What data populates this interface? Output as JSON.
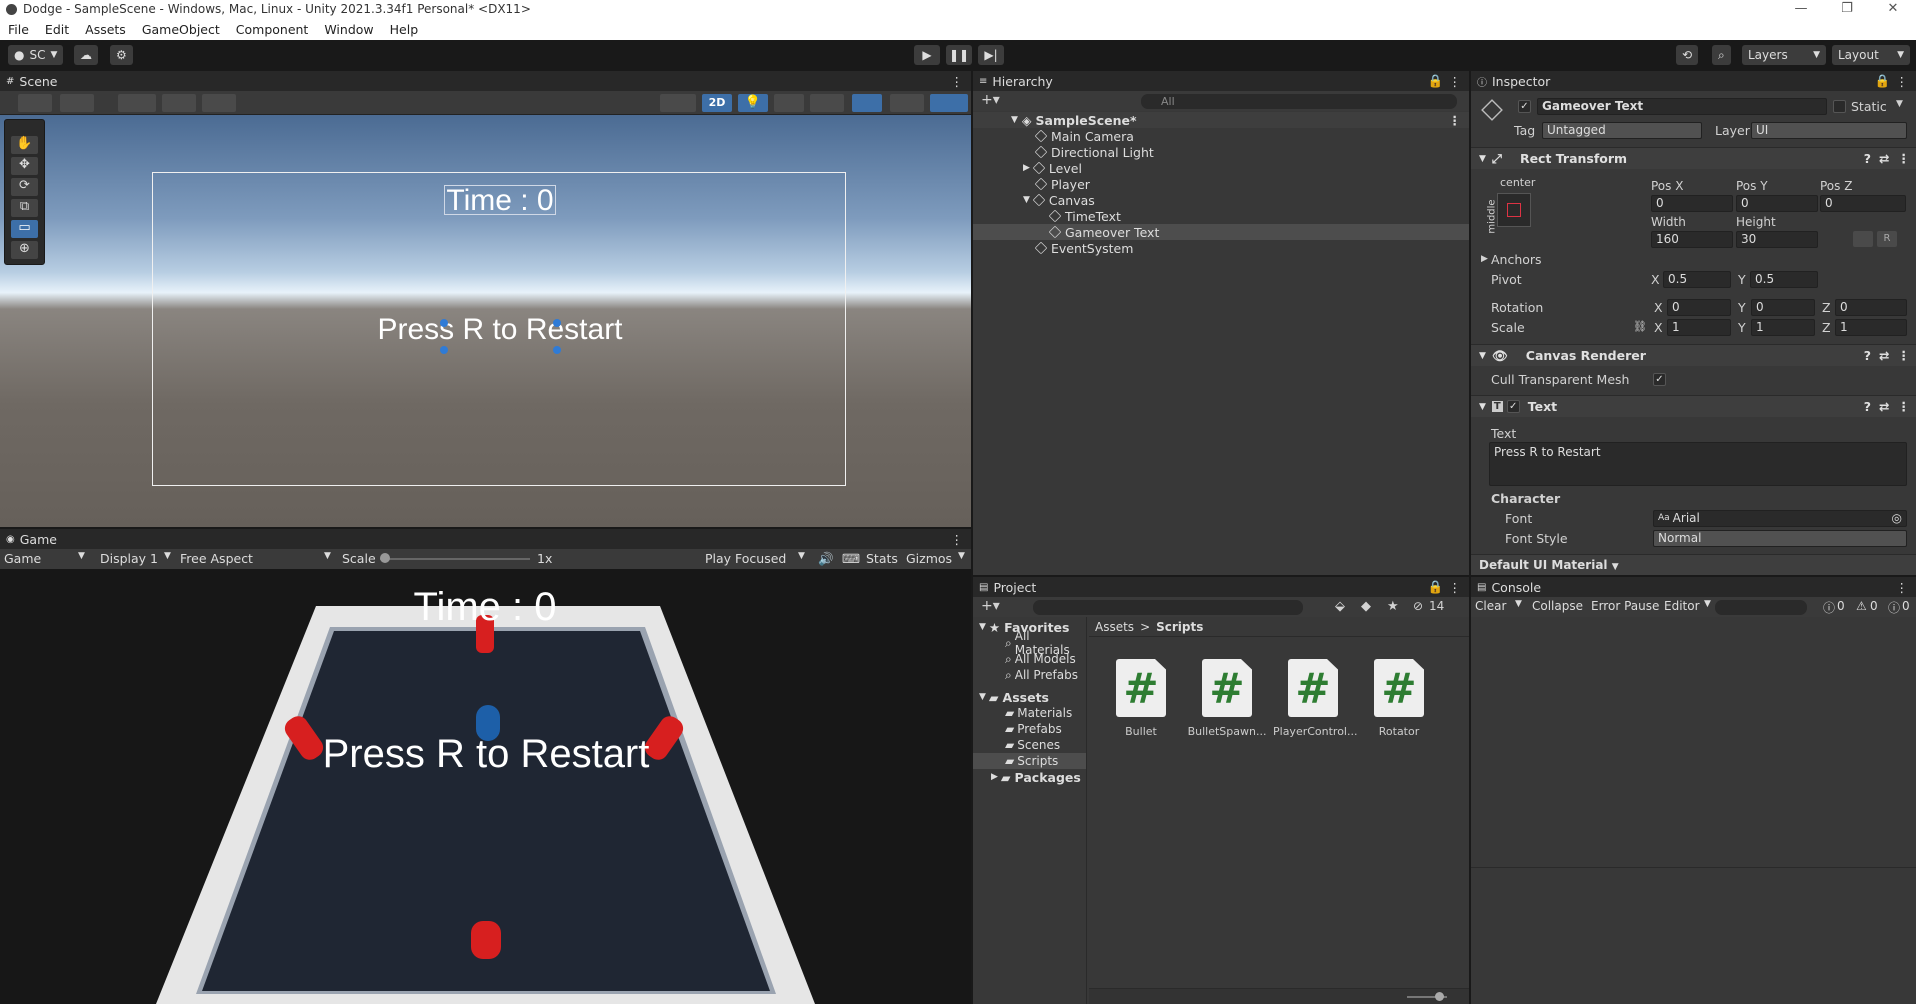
{
  "window": {
    "title": "Dodge - SampleScene - Windows, Mac, Linux - Unity 2021.3.34f1 Personal* <DX11>",
    "controls": [
      "—",
      "❐",
      "✕"
    ]
  },
  "menu": [
    "File",
    "Edit",
    "Assets",
    "GameObject",
    "Component",
    "Window",
    "Help"
  ],
  "toolbar": {
    "account": "SC",
    "layers": "Layers",
    "layout": "Layout"
  },
  "scene": {
    "tab": "Scene",
    "btn_2d": "2D",
    "time_text": "Time : 0",
    "restart_text": "Press R to Restart"
  },
  "game": {
    "tab": "Game",
    "mode": "Game",
    "display": "Display 1",
    "aspect": "Free Aspect",
    "scale_label": "Scale",
    "scale_value": "1x",
    "play_focus": "Play Focused",
    "stats": "Stats",
    "gizmos": "Gizmos",
    "time_text": "Time : 0",
    "restart_text": "Press R to Restart"
  },
  "hierarchy": {
    "tab": "Hierarchy",
    "search_placeholder": "All",
    "items": [
      {
        "label": "SampleScene*",
        "depth": 0
      },
      {
        "label": "Main Camera",
        "depth": 1
      },
      {
        "label": "Directional Light",
        "depth": 1
      },
      {
        "label": "Level",
        "depth": 1
      },
      {
        "label": "Player",
        "depth": 1
      },
      {
        "label": "Canvas",
        "depth": 1
      },
      {
        "label": "TimeText",
        "depth": 2
      },
      {
        "label": "Gameover Text",
        "depth": 2
      },
      {
        "label": "EventSystem",
        "depth": 1
      }
    ]
  },
  "inspector": {
    "tab": "Inspector",
    "object_name": "Gameover Text",
    "static_label": "Static",
    "tag_label": "Tag",
    "tag_value": "Untagged",
    "layer_label": "Layer",
    "layer_value": "UI",
    "rect_transform": {
      "title": "Rect Transform",
      "anchor_h": "center",
      "anchor_v": "middle",
      "pos_x_label": "Pos X",
      "pos_x": "0",
      "pos_y_label": "Pos Y",
      "pos_y": "0",
      "pos_z_label": "Pos Z",
      "pos_z": "0",
      "width_label": "Width",
      "width": "160",
      "height_label": "Height",
      "height": "30",
      "r_btn": "R",
      "anchors": "Anchors",
      "pivot_label": "Pivot",
      "pivot_x": "0.5",
      "pivot_y": "0.5",
      "rotation_label": "Rotation",
      "rot_x": "0",
      "rot_y": "0",
      "rot_z": "0",
      "scale_label": "Scale",
      "scale_x": "1",
      "scale_y": "1",
      "scale_z": "1",
      "x": "X",
      "y": "Y",
      "z": "Z"
    },
    "canvas_renderer": {
      "title": "Canvas Renderer",
      "cull_label": "Cull Transparent Mesh",
      "cull_check": "✓"
    },
    "text_comp": {
      "title": "Text",
      "text_label": "Text",
      "text_value": "Press R to Restart",
      "character": "Character",
      "font_label": "Font",
      "font_value": "Arial",
      "font_prefix": "Aa",
      "style_label": "Font Style",
      "style_value": "Normal"
    },
    "material": "Default UI Material"
  },
  "project": {
    "tab": "Project",
    "hidden_count": "14",
    "favorites": "Favorites",
    "fav_items": [
      "All Materials",
      "All Models",
      "All Prefabs"
    ],
    "assets": "Assets",
    "asset_folders": [
      "Materials",
      "Prefabs",
      "Scenes",
      "Scripts"
    ],
    "packages": "Packages",
    "breadcrumb_root": "Assets",
    "breadcrumb_sep": ">",
    "breadcrumb_current": "Scripts",
    "scripts": [
      "Bullet",
      "BulletSpawn...",
      "PlayerControl...",
      "Rotator"
    ],
    "hash": "#"
  },
  "console": {
    "tab": "Console",
    "clear": "Clear",
    "collapse": "Collapse",
    "error_pause": "Error Pause",
    "editor": "Editor",
    "info_count": "0",
    "warn_count": "0",
    "err_count": "0"
  }
}
